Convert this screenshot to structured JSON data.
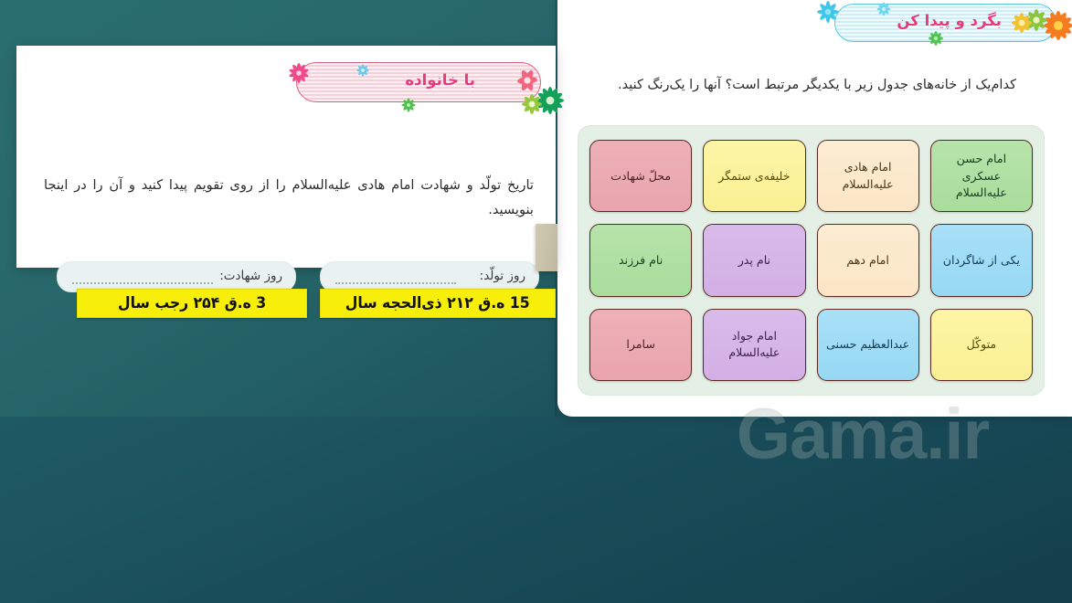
{
  "background": {
    "color_top": "#20616a",
    "color_bottom": "#143f4c"
  },
  "watermark": {
    "text": "Gama.ir"
  },
  "left_panel": {
    "banner": {
      "title": "با خانواده",
      "title_color": "#e8397d",
      "border_color": "#d4607f",
      "flowers": [
        "pink-flower-icon",
        "cyan-flower-icon",
        "green-flower-icon",
        "pink-rose-icon",
        "green-daisy-icon"
      ]
    },
    "instruction": "تاریخ تولّد و شهادت امام هادی علیه‌السلام را از روی تقویم پیدا کنید و آن را در اینجا بنویسید.",
    "fields": [
      {
        "id": "birth",
        "label": "روز تولّد:",
        "placeholder": "...........................................",
        "answer": "15 ه.ق ۲۱۲ ذی‌الحجه سال"
      },
      {
        "id": "martyrdom",
        "label": "روز شهادت:",
        "placeholder": "...........................................",
        "answer": "3 ه.ق ۲۵۴ رجب سال"
      }
    ],
    "highlight_color": "#f7ee09"
  },
  "right_panel": {
    "banner": {
      "title": "بگرد و پیدا کن",
      "title_color": "#e8397d",
      "border_color": "#57c9e2",
      "flowers": [
        "cyan-flower-icon",
        "cyan-flower-icon",
        "green-flower-icon",
        "orange-flower-icon",
        "yellow-flower-icon"
      ]
    },
    "question": "کدام‌یک از خانه‌های جدول زیر با یکدیگر مرتبط است؟ آنها را یک‌رنگ کنید.",
    "table": {
      "background": "#e4efe6",
      "columns": 4,
      "rows": 3,
      "cells": [
        {
          "text": "امام حسن عسکری علیه‌السلام",
          "color": "green",
          "hex": "#b7e3ab"
        },
        {
          "text": "امام هادی علیه‌السلام",
          "color": "cream",
          "hex": "#fcecd2"
        },
        {
          "text": "خلیفه‌ی ستمگر",
          "color": "yellow",
          "hex": "#fcf5a5"
        },
        {
          "text": "محلّ شهادت",
          "color": "pink",
          "hex": "#eeb0b8"
        },
        {
          "text": "یکی از شاگردان",
          "color": "blue",
          "hex": "#a9e0f7"
        },
        {
          "text": "امام دهم",
          "color": "cream",
          "hex": "#fcecd2"
        },
        {
          "text": "نام پدر",
          "color": "purple",
          "hex": "#d9bbea"
        },
        {
          "text": "نام فرزند",
          "color": "green",
          "hex": "#b7e3ab"
        },
        {
          "text": "متوکّل",
          "color": "yellow",
          "hex": "#fcf5a5"
        },
        {
          "text": "عبدالعظیم حسنی",
          "color": "blue",
          "hex": "#a9e0f7"
        },
        {
          "text": "امام جواد علیه‌السلام",
          "color": "purple",
          "hex": "#d9bbea"
        },
        {
          "text": "سامرا",
          "color": "pink",
          "hex": "#eeb0b8"
        }
      ]
    }
  }
}
